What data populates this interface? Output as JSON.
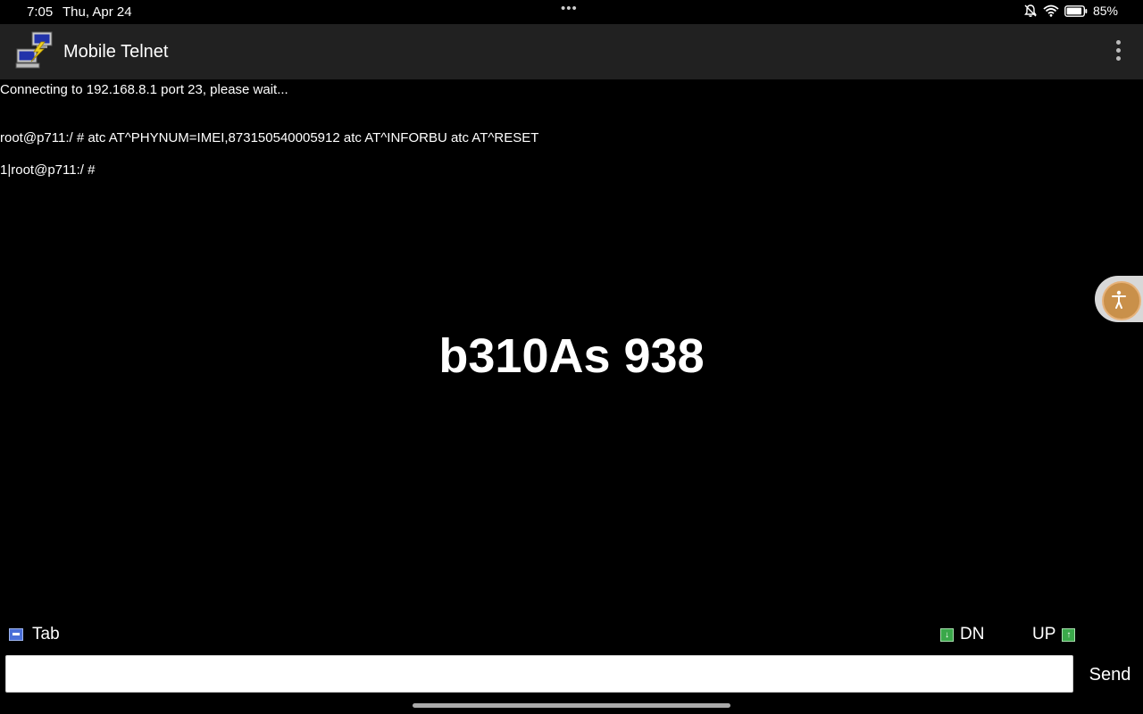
{
  "status_bar": {
    "time": "7:05",
    "date": "Thu, Apr 24",
    "battery": "85%",
    "icons": [
      "mute-bell-icon",
      "wifi-icon",
      "battery-icon"
    ]
  },
  "app_bar": {
    "title": "Mobile Telnet",
    "icon": "telnet-computers-icon",
    "menu_icon": "overflow-menu-icon"
  },
  "terminal": {
    "lines": [
      "Connecting to 192.168.8.1 port 23, please wait...",
      "root@p711:/ # atc AT^PHYNUM=IMEI,873150540005912 atc AT^INFORBU atc AT^RESET",
      "1|root@p711:/ #"
    ]
  },
  "overlay": {
    "text": "b310As 938"
  },
  "keys": {
    "tab": "Tab",
    "dn": "DN",
    "up": "UP"
  },
  "input": {
    "value": "",
    "placeholder": ""
  },
  "send_label": "Send",
  "colors": {
    "app_bar": "#212121",
    "background": "#000000",
    "accessibility": "#c9904a",
    "arrow_key": "#3aa84a",
    "tab_key": "#4a6fd8"
  }
}
